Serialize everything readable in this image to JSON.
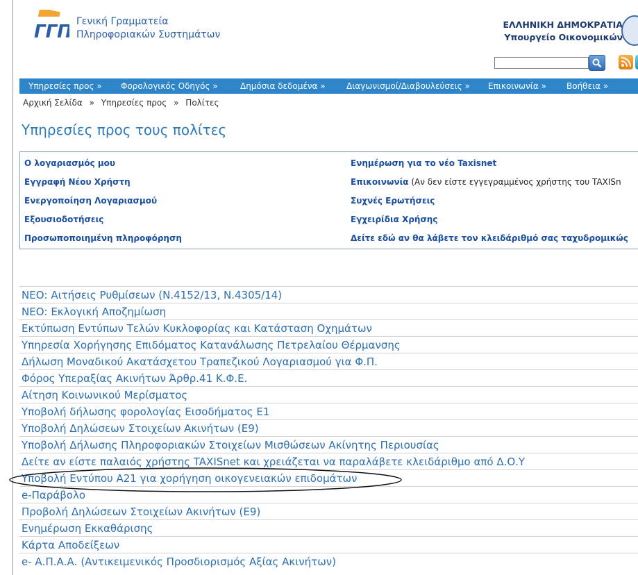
{
  "header": {
    "org_line1": "Γενική Γραμματεία",
    "org_line2": "Πληροφοριακών Συστημάτων",
    "gov_line1": "ΕΛΛΗΝΙΚΗ ΔΗΜΟΚΡΑΤΙΑ",
    "gov_line2": "Υπουργείο Οικονομικών",
    "search_value": "",
    "icons": [
      "search-icon",
      "rss-icon",
      "share-icon"
    ]
  },
  "nav": {
    "items": [
      "Υπηρεσίες προς »",
      "Φορολογικός Οδηγός »",
      "Δημόσια δεδομένα »",
      "Διαγωνισμοί/Διαβουλεύσεις »",
      "Επικοινωνία »",
      "Βοήθεια »"
    ]
  },
  "breadcrumb": [
    "Αρχική Σελίδα",
    "»",
    "Υπηρεσίες προς",
    "»",
    "Πολίτες"
  ],
  "page_title": "Υπηρεσίες προς τους πολίτες",
  "quick_links": {
    "left": [
      "Ο λογαριασμός μου",
      "Εγγραφή Νέου Χρήστη",
      "Ενεργοποίηση Λογαριασμού",
      "Εξουσιοδοτήσεις",
      "Προσωποποιημένη πληροφόρηση"
    ],
    "right": [
      "Ενημέρωση για το νέο Taxisnet",
      "Επικοινωνία",
      "Συχνές Ερωτήσεις",
      "Εγχειρίδια Χρήσης",
      "Δείτε εδώ αν θα λάβετε τον κλειδάριθμό σας ταχυδρομικώς"
    ],
    "contact_note": " (Αν δεν είστε εγγεγραμμένος χρήστης του TAXISn"
  },
  "services": [
    "ΝΕΟ: Αιτήσεις Ρυθμίσεων (Ν.4152/13, Ν.4305/14)",
    "ΝΕΟ: Εκλογική Αποζημίωση",
    "Εκτύπωση Εντύπων Τελών Κυκλοφορίας και Κατάσταση Οχημάτων",
    "Υπηρεσία Χορήγησης Επιδόματος Κατανάλωσης Πετρελαίου Θέρμανσης",
    "Δήλωση Μοναδικού Ακατάσχετου Τραπεζικού Λογαριασμού για Φ.Π.",
    "Φόρος Υπεραξίας Ακινήτων Άρθρ.41 Κ.Φ.Ε.",
    "Αίτηση Κοινωνικού Μερίσματος",
    "Υποβολή δήλωσης φορολογίας Εισοδήματος Ε1",
    "Υποβολή Δηλώσεων Στοιχείων Ακινήτων (Ε9)",
    "Υποβολή Δήλωσης Πληροφοριακών Στοιχείων Μισθώσεων Ακίνητης Περιουσίας",
    "Δείτε αν είστε παλαιός χρήστης TAXISnet και χρειάζεται να παραλάβετε κλειδάριθμο από Δ.Ο.Υ",
    "Υποβολή Εντύπου Α21 για χορήγηση οικογενειακών επιδομάτων",
    "e-Παράβολο",
    "Προβολή Δηλώσεων Στοιχείων Ακινήτων (Ε9)",
    "Ενημέρωση Εκκαθάρισης",
    "Κάρτα Αποδείξεων",
    "e- Α.Π.Α.Α. (Αντικειμενικός Προσδιορισμός Αξίας Ακινήτων)"
  ],
  "colors": {
    "nav_bg": "#2e86c9",
    "link_blue": "#2c6fb0",
    "title_blue": "#2c7ab8"
  }
}
